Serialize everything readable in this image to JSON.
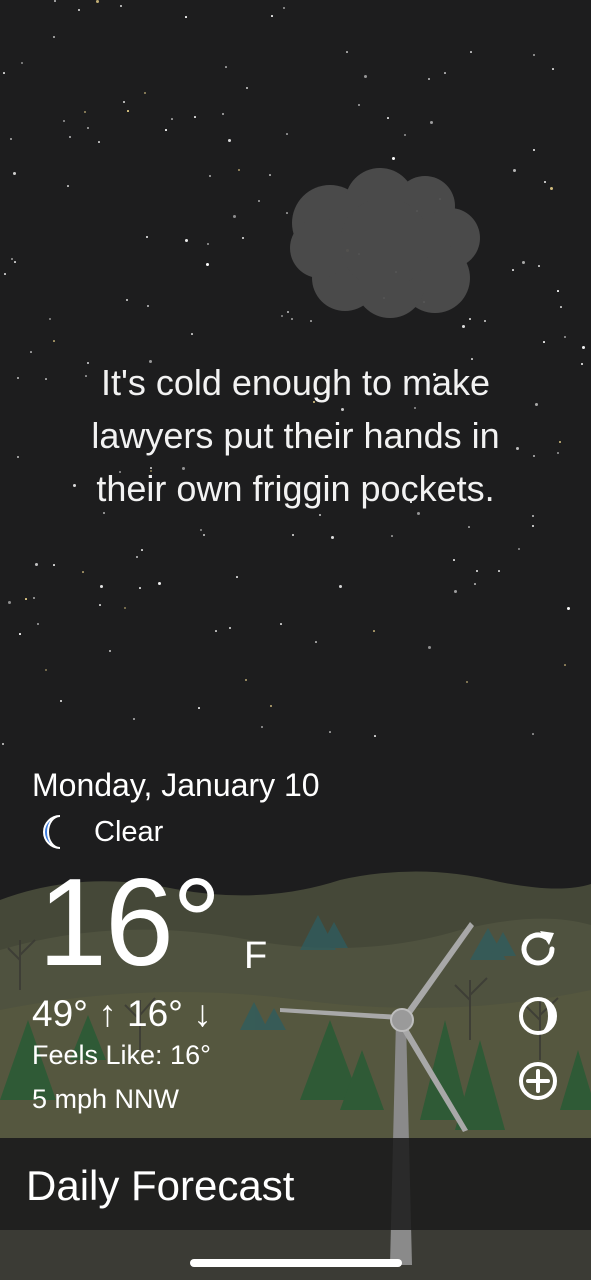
{
  "quote": {
    "line1": "It's cold enough to make",
    "line2": "lawyers put their hands in",
    "line3": "their own friggin pockets."
  },
  "weather": {
    "date": "Monday, January 10",
    "condition": "Clear",
    "condition_icon": "moon-icon",
    "temperature": "16°",
    "unit": "F",
    "high_low": "49° ↑ 16° ↓",
    "feels_like": "Feels Like: 16°",
    "wind": "5 mph NNW"
  },
  "actions": {
    "refresh_icon": "refresh-icon",
    "moon_phase_icon": "moon-phase-icon",
    "add_icon": "add-location-icon"
  },
  "bottom_bar": {
    "label": "Daily Forecast"
  },
  "colors": {
    "sky": "#1d1d1e",
    "moon_blue": "#3d7de0",
    "hills": "#4b4e3c",
    "trees": "#2f5a3a"
  }
}
